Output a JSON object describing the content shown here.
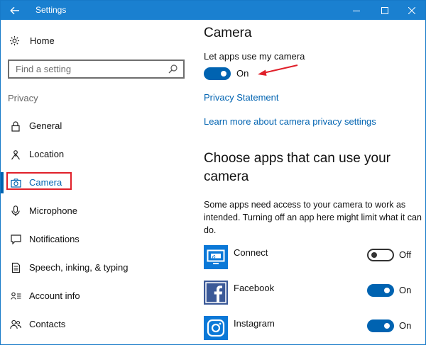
{
  "window": {
    "title": "Settings",
    "accent": "#1a80d0"
  },
  "sidebar": {
    "home_label": "Home",
    "search_placeholder": "Find a setting",
    "section_label": "Privacy",
    "items": [
      {
        "label": "General",
        "icon": "lock-icon"
      },
      {
        "label": "Location",
        "icon": "location-icon"
      },
      {
        "label": "Camera",
        "icon": "camera-icon",
        "active": true
      },
      {
        "label": "Microphone",
        "icon": "microphone-icon"
      },
      {
        "label": "Notifications",
        "icon": "notifications-icon"
      },
      {
        "label": "Speech, inking, & typing",
        "icon": "speech-icon"
      },
      {
        "label": "Account info",
        "icon": "account-info-icon"
      },
      {
        "label": "Contacts",
        "icon": "contacts-icon"
      }
    ]
  },
  "main": {
    "title": "Camera",
    "master_toggle": {
      "label": "Let apps use my camera",
      "state": "On",
      "on": true
    },
    "links": {
      "privacy_statement": "Privacy Statement",
      "learn_more": "Learn more about camera privacy settings"
    },
    "apps_heading": "Choose apps that can use your camera",
    "apps_description": "Some apps need access to your camera to work as intended. Turning off an app here might limit what it can do.",
    "apps": [
      {
        "name": "Connect",
        "state": "Off",
        "on": false,
        "icon": "connect-app-icon"
      },
      {
        "name": "Facebook",
        "state": "On",
        "on": true,
        "icon": "facebook-app-icon"
      },
      {
        "name": "Instagram",
        "state": "On",
        "on": true,
        "icon": "instagram-app-icon"
      }
    ]
  },
  "colors": {
    "link": "#0063b1",
    "highlight_box": "#e0202a",
    "annotation_arrow": "#e0202a"
  }
}
